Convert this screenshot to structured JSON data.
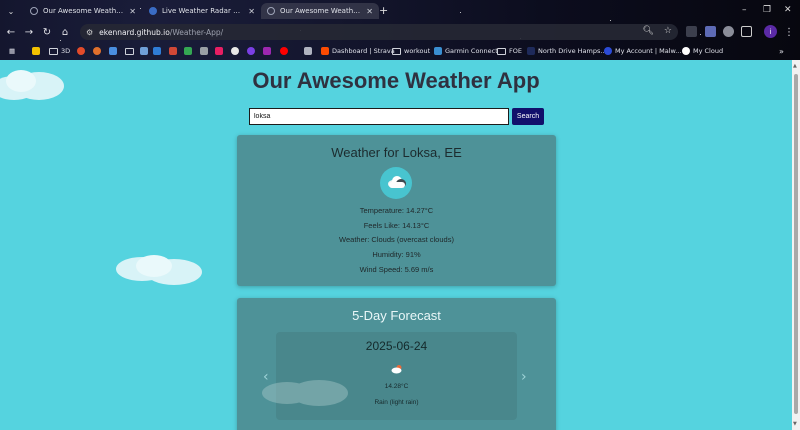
{
  "browser": {
    "tabs": [
      {
        "title": "Our Awesome Weather App",
        "active": false
      },
      {
        "title": "Live Weather Radar Map (Rain...",
        "active": false
      },
      {
        "title": "Our Awesome Weather App",
        "active": true
      }
    ],
    "new_tab_label": "+",
    "url_host": "ekennard.github.io",
    "url_path": "/Weather-App/",
    "profile_initial": "i",
    "bookmarks": [
      {
        "label": "3D",
        "type": "folder"
      },
      {
        "label": "Dashboard | Strava",
        "type": "site",
        "color": "#fc4c02"
      },
      {
        "label": "workout",
        "type": "folder"
      },
      {
        "label": "Garmin Connect",
        "type": "site",
        "color": "#3a8fd1"
      },
      {
        "label": "FOE",
        "type": "folder"
      },
      {
        "label": "North Drive Hamps...",
        "type": "site",
        "color": "#1e2a5a"
      },
      {
        "label": "My Account | Malw...",
        "type": "site",
        "color": "#2b4bd6"
      },
      {
        "label": "My Cloud",
        "type": "site",
        "color": "#ffffff"
      }
    ]
  },
  "app": {
    "title": "Our Awesome Weather App",
    "search": {
      "value": "loksa",
      "button_label": "Search"
    },
    "current": {
      "heading": "Weather for Loksa, EE",
      "icon": "clouds-icon",
      "temperature": "Temperature: 14.27°C",
      "feels_like": "Feels Like: 14.13°C",
      "weather": "Weather: Clouds (overcast clouds)",
      "humidity": "Humidity: 91%",
      "wind": "Wind Speed: 5.69 m/s"
    },
    "forecast": {
      "heading": "5-Day Forecast",
      "items": [
        {
          "date": "2025-06-24",
          "icon": "light-rain-icon",
          "temp": "14.28°C",
          "desc": "Rain (light rain)"
        }
      ]
    }
  },
  "colors": {
    "page_bg": "#55d3df",
    "card_bg": "#4e9298",
    "button_bg": "#11106b"
  }
}
